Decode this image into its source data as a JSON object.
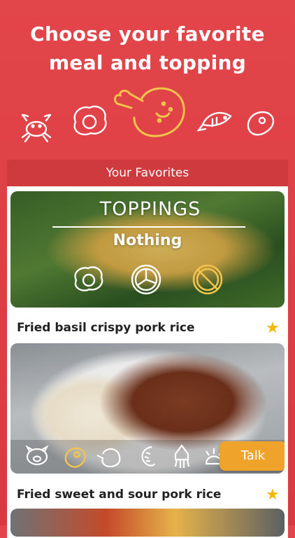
{
  "headline": {
    "line1": "Choose your favorite",
    "line2": "meal and topping"
  },
  "category_icons": [
    "crab-icon",
    "fried-egg-icon",
    "chicken-icon",
    "fish-icon",
    "steak-icon"
  ],
  "panel": {
    "title": "Your Favorites"
  },
  "toppings_card": {
    "title": "TOPPINGS",
    "value": "Nothing",
    "options": [
      "fried-egg-icon",
      "century-egg-icon",
      "no-topping-icon"
    ],
    "selected": "no-topping-icon"
  },
  "meals": [
    {
      "name": "Fried basil crispy pork rice",
      "favorite": true
    },
    {
      "name": "Fried sweet and sour pork rice",
      "favorite": true
    }
  ],
  "meat_options": [
    "pork-icon",
    "beef-icon",
    "chicken-icon",
    "shrimp-icon",
    "squid-icon",
    "shellfish-icon"
  ],
  "meat_selected": "beef-icon",
  "talk_button": {
    "label": "Talk"
  },
  "colors": {
    "background": "#e2454a",
    "accent": "#f0c040",
    "talk": "#f0a32a",
    "star": "#f2b705"
  }
}
